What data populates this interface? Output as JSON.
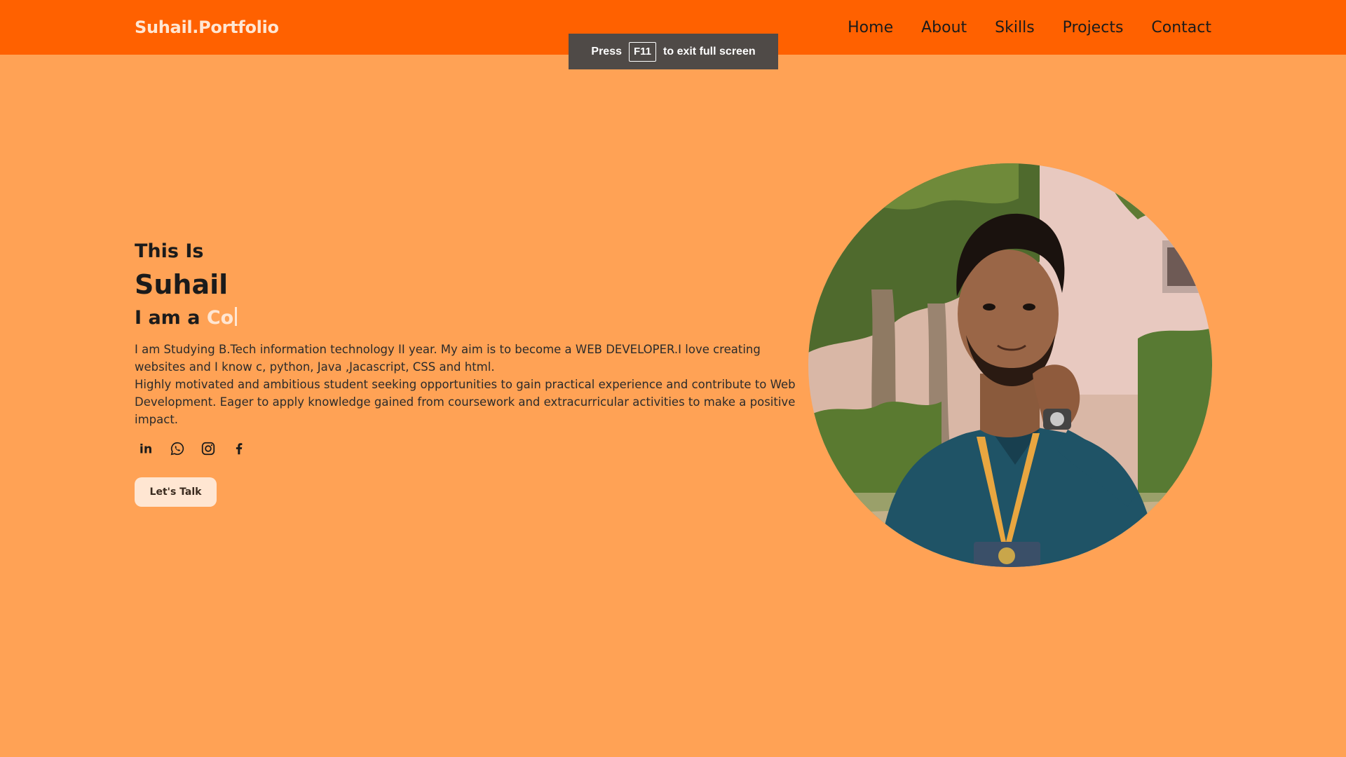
{
  "brand": "Suhail.Portfolio",
  "nav": {
    "items": [
      {
        "label": "Home"
      },
      {
        "label": "About"
      },
      {
        "label": "Skills"
      },
      {
        "label": "Projects"
      },
      {
        "label": "Contact"
      }
    ]
  },
  "fullscreen_toast": {
    "prefix": "Press",
    "key": "F11",
    "suffix": "to exit full screen"
  },
  "hero": {
    "intro": "This Is",
    "name": "Suhail",
    "role_prefix": "I am a",
    "role_typed": "Co",
    "bio_line1": "I am Studying B.Tech information technology II year. My aim is to become a WEB DEVELOPER.I love creating websites and I know c, python, Java ,Jacascript, CSS and html.",
    "bio_line2": "Highly motivated and ambitious student seeking opportunities to gain practical experience and contribute to Web Development. Eager to apply knowledge gained from coursework and extracurricular activities to make a positive impact.",
    "cta_label": "Let's Talk"
  },
  "socials": [
    {
      "icon": "linkedin-icon"
    },
    {
      "icon": "whatsapp-icon"
    },
    {
      "icon": "instagram-icon"
    },
    {
      "icon": "facebook-icon"
    }
  ],
  "colors": {
    "navbar_bg": "#FF6100",
    "page_bg": "#FFA255",
    "accent_light": "#FFE6D2",
    "text_dark": "#1b1b1b",
    "toast_bg": "#4F4A47"
  }
}
